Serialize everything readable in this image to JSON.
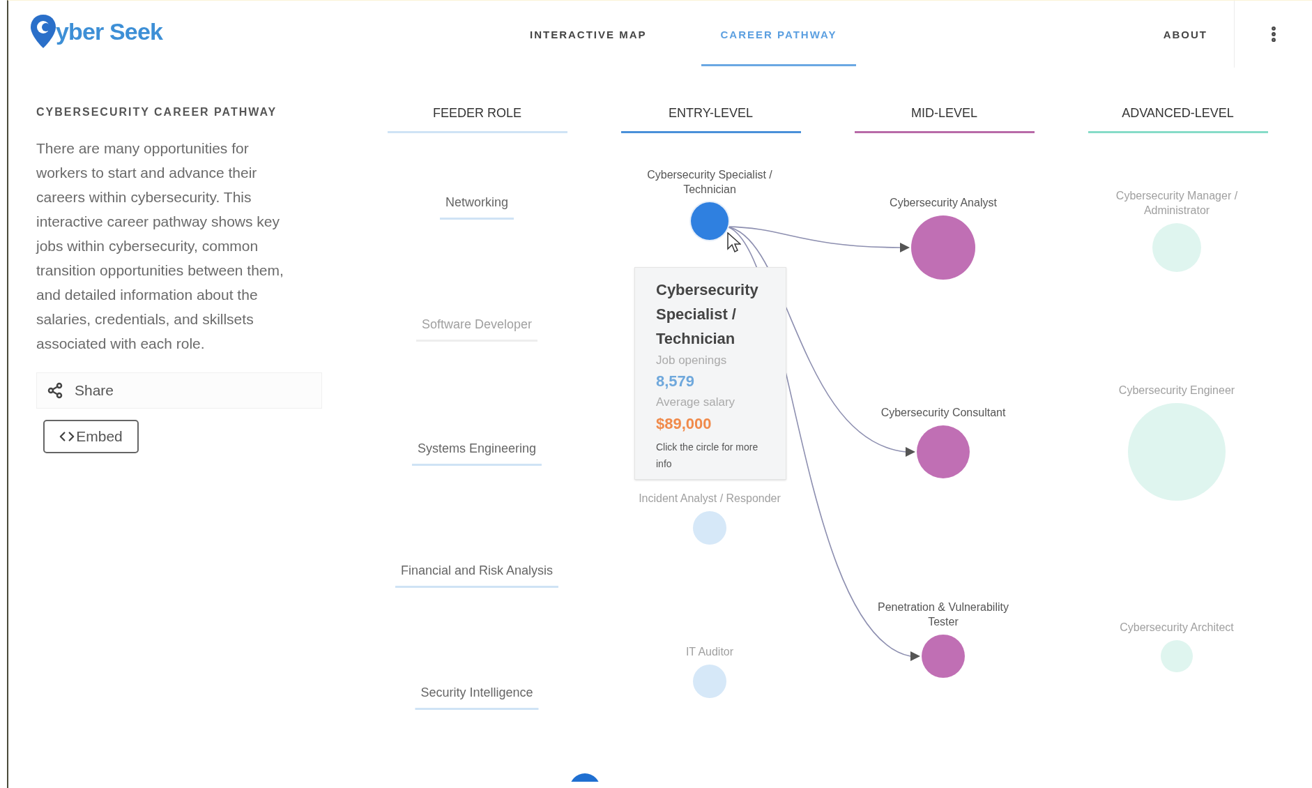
{
  "header": {
    "logo": "yber Seek",
    "nav": [
      {
        "label": "INTERACTIVE MAP",
        "selected": false
      },
      {
        "label": "CAREER PATHWAY",
        "selected": true
      }
    ],
    "about": {
      "label": "ABOUT",
      "selected": false
    }
  },
  "sidebar": {
    "title": "CYBERSECURITY CAREER PATHWAY",
    "description": "There are many opportunities for workers to start and advance their careers within cybersecurity. This interactive career pathway shows key jobs within cybersecurity, common transition opportunities between them, and detailed information about the salaries, credentials, and skillsets associated with each role.",
    "share": "Share",
    "embed": "Embed"
  },
  "columns": [
    {
      "kind": "feeder",
      "title": "FEEDER ROLE",
      "roles": [
        {
          "label": "Networking",
          "dimmed": false
        },
        {
          "label": "Software Developer",
          "dimmed": true
        },
        {
          "label": "Systems Engineering",
          "dimmed": false
        },
        {
          "label": "Financial and Risk Analysis",
          "dimmed": false
        },
        {
          "label": "Security Intelligence",
          "dimmed": false
        }
      ]
    },
    {
      "kind": "entry",
      "title": "ENTRY-LEVEL",
      "nodes": [
        {
          "label": "Cybersecurity Specialist / Technician",
          "selected": true,
          "dimmed": false
        },
        {
          "label": "Incident Analyst / Responder",
          "selected": false,
          "dimmed": true
        },
        {
          "label": "IT Auditor",
          "selected": false,
          "dimmed": true
        }
      ]
    },
    {
      "kind": "mid",
      "title": "MID-LEVEL",
      "nodes": [
        {
          "label": "Cybersecurity Analyst",
          "selected": false,
          "dimmed": false,
          "incoming_arrow": true
        },
        {
          "label": "Cybersecurity Consultant",
          "selected": false,
          "dimmed": false,
          "incoming_arrow": true
        },
        {
          "label": "Penetration & Vulnerability Tester",
          "selected": false,
          "dimmed": false,
          "incoming_arrow": true
        }
      ]
    },
    {
      "kind": "advanced",
      "title": "ADVANCED-LEVEL",
      "nodes": [
        {
          "label": "Cybersecurity Manager / Administrator",
          "selected": false,
          "dimmed": true
        },
        {
          "label": "Cybersecurity Engineer",
          "selected": false,
          "dimmed": true
        },
        {
          "label": "Cybersecurity Architect",
          "selected": false,
          "dimmed": true
        }
      ]
    }
  ],
  "tooltip": {
    "title": "Cybersecurity Specialist / Technician",
    "openings_label": "Job openings",
    "openings": "8,579",
    "salary_label": "Average salary",
    "salary": "$89,000",
    "hint": "Click the circle for more info"
  }
}
